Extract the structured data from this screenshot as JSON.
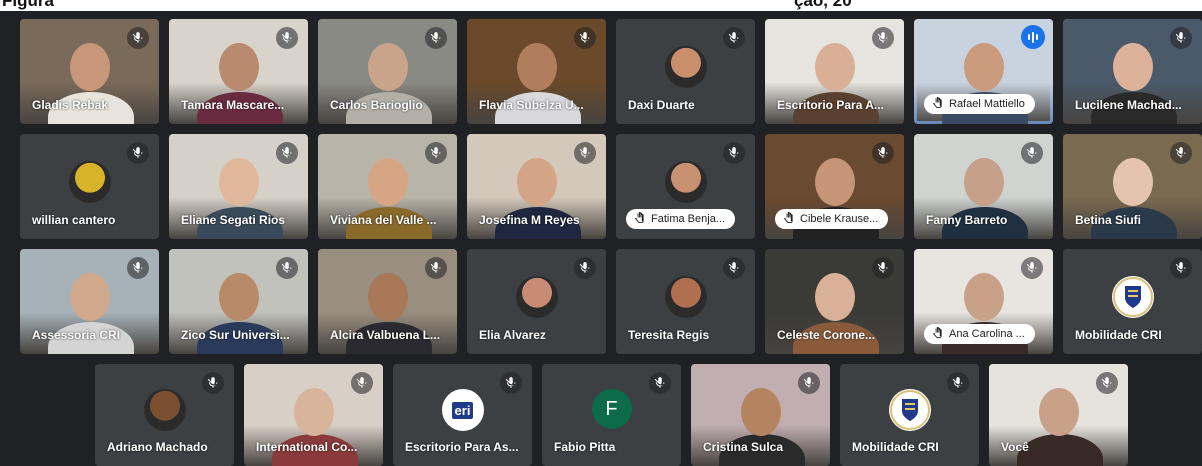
{
  "header": {
    "left": "Figura",
    "right": "ção, 20"
  },
  "participants": [
    {
      "name": "Gladis Rebak",
      "kind": "video",
      "bg": "#7a6a5a",
      "skin": "#c8977a",
      "shirt": "#e8e4dc"
    },
    {
      "name": "Tamara Mascare...",
      "kind": "video",
      "bg": "#d8d4cc",
      "skin": "#b98a6e",
      "shirt": "#6a2b40"
    },
    {
      "name": "Carlos Barioglio",
      "kind": "video",
      "bg": "#8a8a84",
      "skin": "#c9a48a",
      "shirt": "#b4b0a8"
    },
    {
      "name": "Flavia Subelza U...",
      "kind": "video",
      "bg": "#6a4a2a",
      "skin": "#b07e5c",
      "shirt": "#d9d9dc"
    },
    {
      "name": "Daxi Duarte",
      "kind": "avatar",
      "avatar_color": "#c98f6a"
    },
    {
      "name": "Escritorio Para A...",
      "kind": "video",
      "bg": "#e6e4de",
      "skin": "#d9b096",
      "shirt": "#5a4030"
    },
    {
      "name": "Rafael Mattiello",
      "kind": "video-pill",
      "bg": "#c9d3e0",
      "skin": "#c99b7c",
      "shirt": "#3b4a63",
      "speaking": true
    },
    {
      "name": "Lucilene Machad...",
      "kind": "video",
      "bg": "#4a5a6a",
      "skin": "#dcb29a",
      "shirt": "#2a2a2a"
    },
    {
      "name": "willian cantero",
      "kind": "avatar",
      "avatar_color": "#d8b32a"
    },
    {
      "name": "Eliane Segati Rios",
      "kind": "video",
      "bg": "#d5d0c8",
      "skin": "#e0b79a",
      "shirt": "#3a4a5a"
    },
    {
      "name": "Viviana del Valle ...",
      "kind": "video",
      "bg": "#b9b4a8",
      "skin": "#d6a684",
      "shirt": "#8a6a2a"
    },
    {
      "name": "Josefina M Reyes",
      "kind": "video",
      "bg": "#d3c8ba",
      "skin": "#d4a486",
      "shirt": "#1f2840"
    },
    {
      "name": "Fatima Benja...",
      "kind": "avatar-pill",
      "avatar_color": "#c89272"
    },
    {
      "name": "Cibele Krause...",
      "kind": "video-pill",
      "bg": "#6a4a30",
      "skin": "#c69476",
      "shirt": "#222222"
    },
    {
      "name": "Fanny Barreto",
      "kind": "video",
      "bg": "#cfd4d0",
      "skin": "#c6a088",
      "shirt": "#203040"
    },
    {
      "name": "Betina Siufi",
      "kind": "video",
      "bg": "#7a6a50",
      "skin": "#e4c4ae",
      "shirt": "#2a3a4a"
    },
    {
      "name": "Assessoria CRI",
      "kind": "video",
      "bg": "#a6b2b8",
      "skin": "#d0a88c",
      "shirt": "#d4d4d4"
    },
    {
      "name": "Zico Sur Universi...",
      "kind": "video",
      "bg": "#c2c2bc",
      "skin": "#b88a6a",
      "shirt": "#2a3a5a"
    },
    {
      "name": "Alcira Valbuena L...",
      "kind": "video",
      "bg": "#9a8e80",
      "skin": "#a87858",
      "shirt": "#2a2a30"
    },
    {
      "name": "Elia Alvarez",
      "kind": "avatar",
      "avatar_color": "#c88c74"
    },
    {
      "name": "Teresita Regis",
      "kind": "avatar",
      "avatar_color": "#b07050"
    },
    {
      "name": "Celeste Corone...",
      "kind": "video",
      "bg": "#3a3a36",
      "skin": "#d9b098",
      "shirt": "#8a5a3a"
    },
    {
      "name": "Ana Carolina ...",
      "kind": "video-pill",
      "bg": "#e8e4e0",
      "skin": "#c9a088",
      "shirt": "#3a2a2a"
    },
    {
      "name": "Mobilidade CRI",
      "kind": "crest"
    },
    {
      "name": "Adriano Machado",
      "kind": "avatar",
      "avatar_color": "#7a5030"
    },
    {
      "name": "International Co...",
      "kind": "video",
      "bg": "#d8cfc6",
      "skin": "#d9b49c",
      "shirt": "#8a3a3a"
    },
    {
      "name": "Escritorio Para As...",
      "kind": "eri",
      "logo_text": "eri"
    },
    {
      "name": "Fabio Pitta",
      "kind": "letter",
      "letter": "F"
    },
    {
      "name": "Cristina Sulca",
      "kind": "video",
      "bg": "#c0aeb0",
      "skin": "#b48460",
      "shirt": "#2a2a2a"
    },
    {
      "name": "Mobilidade CRI",
      "kind": "crest"
    },
    {
      "name": "Você",
      "kind": "video",
      "bg": "#e6e2dc",
      "skin": "#c9a088",
      "shirt": "#3a2a26"
    }
  ]
}
